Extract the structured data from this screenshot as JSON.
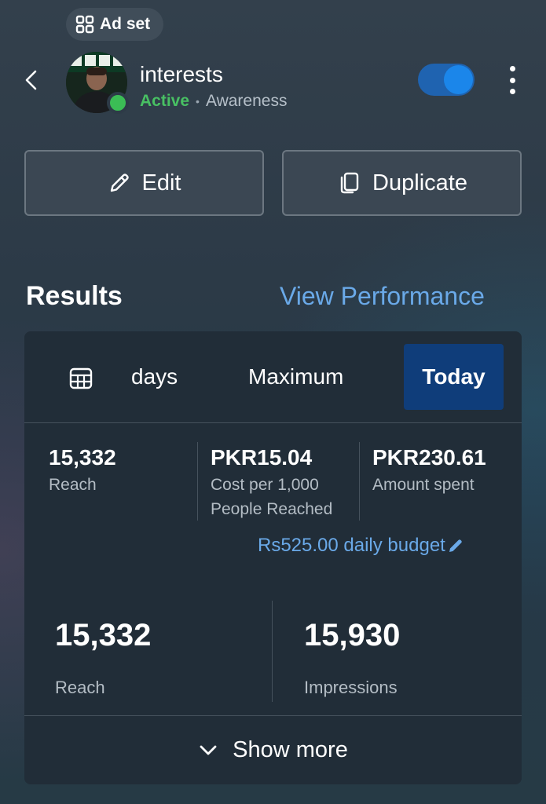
{
  "header": {
    "chip_label": "Ad set",
    "ad_set_name": "interests",
    "status": "Active",
    "objective": "Awareness",
    "separator": "•",
    "toggle_on": true
  },
  "actions": {
    "edit_label": "Edit",
    "duplicate_label": "Duplicate"
  },
  "results": {
    "title": "Results",
    "view_performance": "View Performance",
    "date_tabs": [
      {
        "label": "days",
        "selected": false
      },
      {
        "label": "Maximum",
        "selected": false
      },
      {
        "label": "Today",
        "selected": true
      }
    ],
    "metrics": [
      {
        "value": "15,332",
        "label": "Reach"
      },
      {
        "value": "PKR15.04",
        "label": "Cost per 1,000 People Reached"
      },
      {
        "value": "PKR230.61",
        "label": "Amount spent"
      }
    ],
    "daily_budget": "Rs525.00 daily budget",
    "summary": [
      {
        "value": "15,332",
        "label": "Reach"
      },
      {
        "value": "15,930",
        "label": "Impressions"
      }
    ],
    "show_more": "Show more"
  },
  "colors": {
    "accent_link": "#6aa9e8",
    "active_green": "#48c063",
    "toggle": "#1b86ea",
    "selected_tab": "#0f3d7a"
  },
  "icons": [
    "grid-icon",
    "chevron-left-icon",
    "kebab-icon",
    "pencil-icon",
    "duplicate-icon",
    "calendar-icon",
    "chevron-down-icon"
  ]
}
